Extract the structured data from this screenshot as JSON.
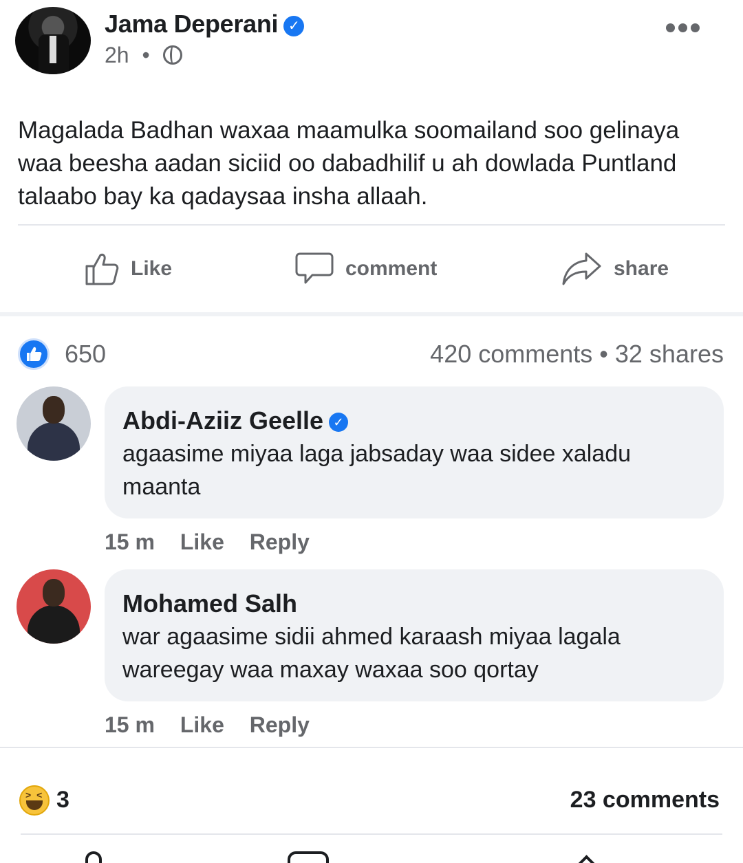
{
  "post": {
    "author": "Jama Deperani",
    "time": "2h",
    "separator": "•",
    "body": "Magalada Badhan waxaa maamulka soomailand soo gelinaya waa beesha aadan siciid oo dabadhilif u ah dowlada Puntland talaabo bay ka qadaysaa insha allaah."
  },
  "actions": {
    "like": "Like",
    "comment": "comment",
    "share": "share"
  },
  "stats": {
    "likes": "650",
    "comments_shares": "420 comments • 32 shares"
  },
  "comments": [
    {
      "name": "Abdi-Aziiz Geelle",
      "verified": true,
      "text": "agaasime miyaa laga jabsaday waa sidee xaladu maanta",
      "time": "15 m",
      "like": "Like",
      "reply": "Reply"
    },
    {
      "name": "Mohamed Salh",
      "verified": false,
      "text": "war agaasime sidii ahmed karaash miyaa lagala wareegay waa maxay waxaa soo qortay",
      "time": "15 m",
      "like": "Like",
      "reply": "Reply"
    }
  ],
  "footer": {
    "reaction_count": "3",
    "comments": "23 comments"
  },
  "colors": {
    "accent": "#1877f2",
    "muted": "#65676b",
    "bubble": "#f0f2f5"
  }
}
